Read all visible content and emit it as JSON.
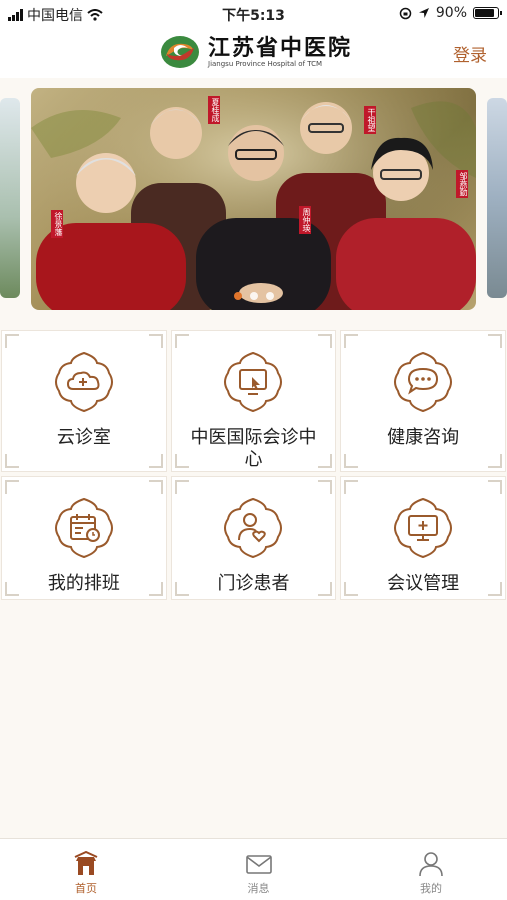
{
  "status": {
    "carrier": "中国电信",
    "time": "下午5:13",
    "battery": "90%",
    "battery_level": 0.9
  },
  "header": {
    "logo_cn": "江苏省中医院",
    "logo_en": "Jiangsu Province Hospital of TCM",
    "login_label": "登录"
  },
  "banner": {
    "slides": 3,
    "active_slide": 0,
    "names": [
      "周仲瑛",
      "干祖望",
      "夏桂成",
      "徐景藩",
      "邹燕勤"
    ]
  },
  "grid": [
    {
      "label": "云诊室",
      "icon": "cloud-plus-icon"
    },
    {
      "label": "中医国际会诊中心",
      "icon": "monitor-cursor-icon"
    },
    {
      "label": "健康咨询",
      "icon": "chat-bubble-icon"
    },
    {
      "label": "我的排班",
      "icon": "calendar-clock-icon"
    },
    {
      "label": "门诊患者",
      "icon": "patient-heart-icon"
    },
    {
      "label": "会议管理",
      "icon": "monitor-plus-icon"
    }
  ],
  "tabs": [
    {
      "label": "首页",
      "icon": "home-icon",
      "active": true
    },
    {
      "label": "消息",
      "icon": "mail-icon",
      "active": false
    },
    {
      "label": "我的",
      "icon": "person-icon",
      "active": false
    }
  ],
  "colors": {
    "accent": "#b0612e",
    "icon": "#9a5a2c",
    "background": "#fbf8f3"
  }
}
